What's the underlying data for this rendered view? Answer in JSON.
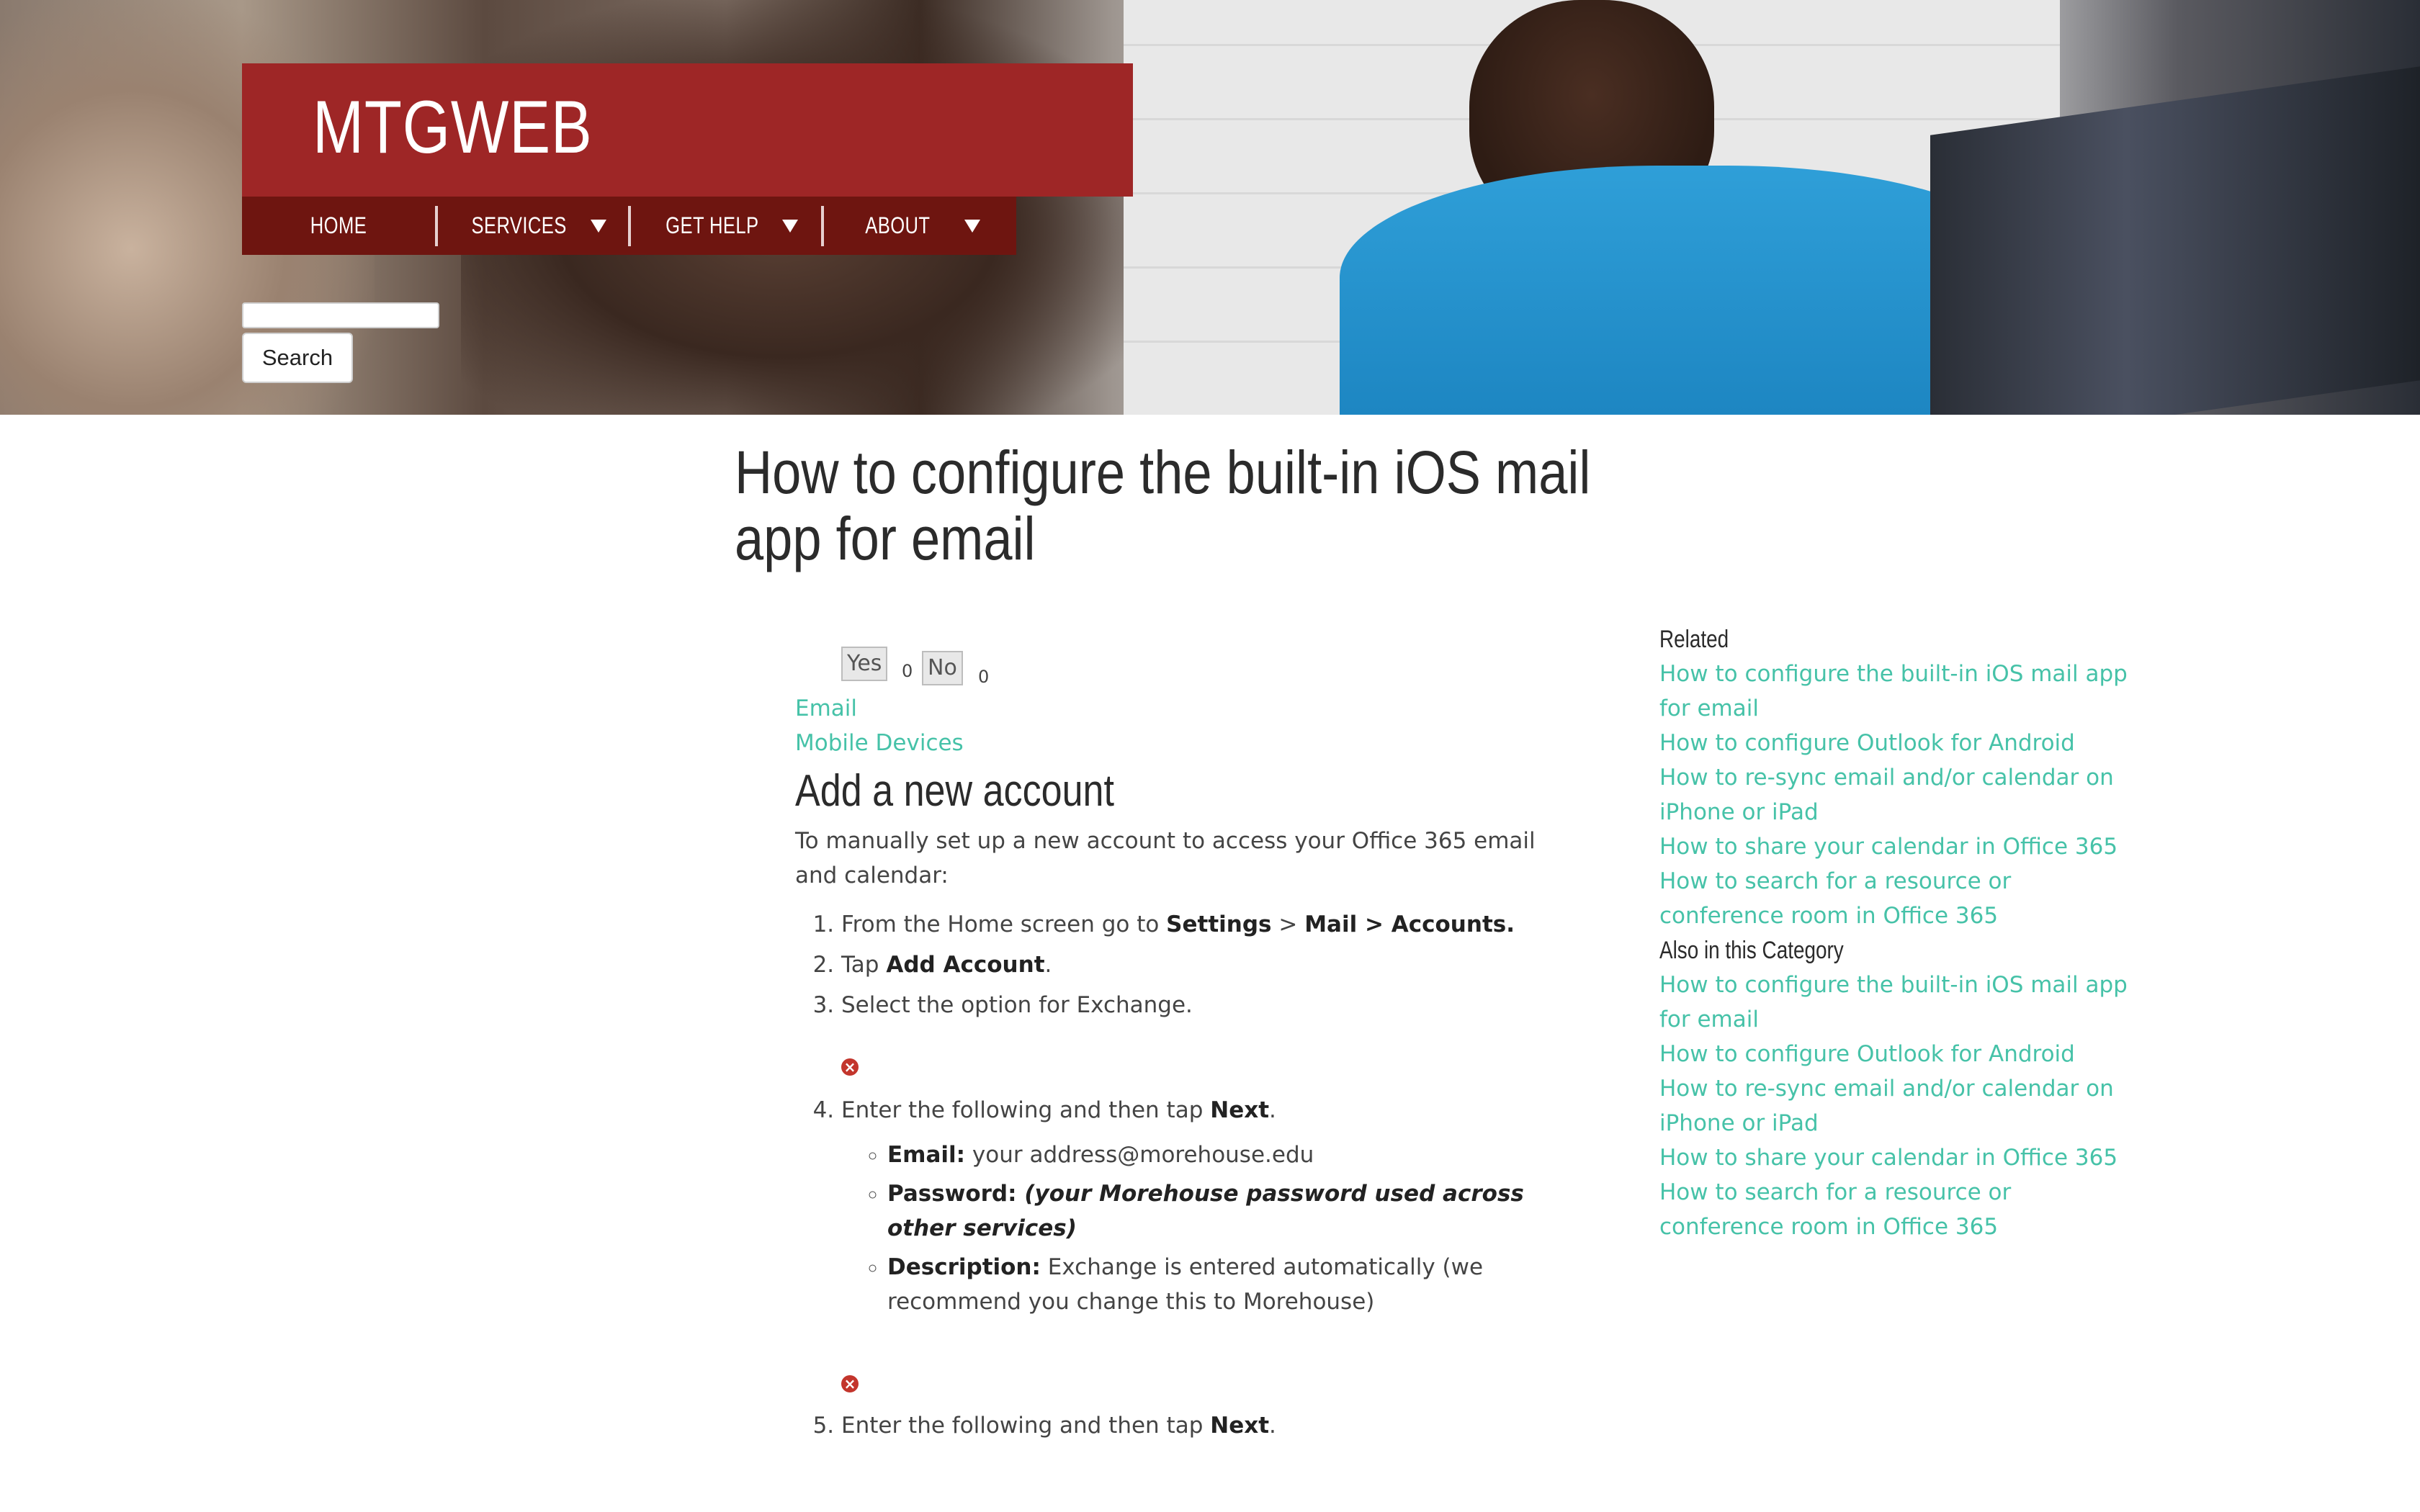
{
  "site": {
    "name": "MTGWEB"
  },
  "nav": {
    "items": [
      {
        "label": "HOME",
        "dropdown": false
      },
      {
        "label": "SERVICES",
        "dropdown": true
      },
      {
        "label": "GET HELP",
        "dropdown": true
      },
      {
        "label": "ABOUT",
        "dropdown": true
      }
    ]
  },
  "search": {
    "value": "",
    "button": "Search"
  },
  "article": {
    "title": "How to configure the built-in iOS mail app for email",
    "vote": {
      "yes_label": "Yes",
      "yes_count": "0",
      "no_label": "No",
      "no_count": "0"
    },
    "tags": [
      "Email",
      "Mobile Devices"
    ],
    "heading": "Add a new account",
    "intro": "To manually set up a new account to access your Office 365 email and calendar:",
    "steps": {
      "s1_pre": "From the Home screen go to ",
      "s1_b1": "Settings",
      "s1_mid": " > ",
      "s1_b2": "Mail > Accounts.",
      "s2_pre": "Tap ",
      "s2_b": "Add Account",
      "s2_post": ".",
      "s3": "Select the option for Exchange.",
      "s4_pre": "Enter the following and then tap ",
      "s4_b": "Next",
      "s4_post": ".",
      "s5_pre": "Enter the following and then tap ",
      "s5_b": "Next",
      "s5_post": "."
    },
    "fields": {
      "email_label": "Email:",
      "email_value": " your address@morehouse.edu",
      "password_label": "Password:",
      "password_value": " (your Morehouse password used across other services)",
      "description_label": "Description:",
      "description_value": " Exchange is entered automatically (we recommend you change this to Morehouse)"
    }
  },
  "sidebar": {
    "related_heading": "Related",
    "related": [
      "How to configure the built-in iOS mail app for email",
      "How to configure Outlook for Android",
      "How to re-sync email and/or calendar on iPhone or iPad",
      "How to share your calendar in Office 365",
      "How to search for a resource or conference room in Office 365"
    ],
    "category_heading": "Also in this Category",
    "category": [
      "How to configure the built-in iOS mail app for email",
      "How to configure Outlook for Android",
      "How to re-sync email and/or calendar on iPhone or iPad",
      "How to share your calendar in Office 365",
      "How to search for a resource or conference room in Office 365"
    ]
  },
  "colors": {
    "brand": "#9e2626",
    "nav": "#6e1510",
    "link": "#46c2a8",
    "error_icon": "#c3352c"
  },
  "icons": {
    "broken_image": "error-x-icon",
    "dropdown": "triangle-down-icon"
  }
}
